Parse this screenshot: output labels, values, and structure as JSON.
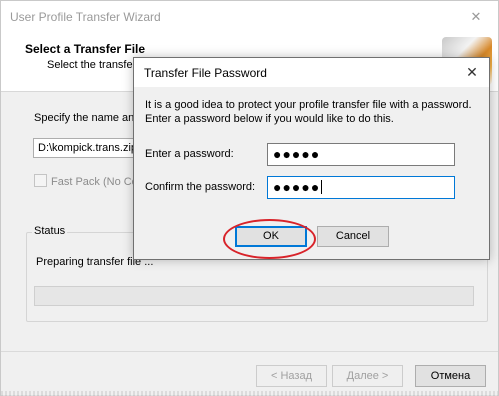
{
  "wizard": {
    "title": "User Profile Transfer Wizard",
    "close_glyph": "✕",
    "header_title": "Select a Transfer File",
    "header_subtitle": "Select the transfer f",
    "specify_label": "Specify the name and",
    "file_path": "D:\\kompick.trans.zip",
    "fast_pack_label": "Fast Pack (No Co",
    "status_label": "Status",
    "status_text": "Preparing transfer file ...",
    "progress": 0,
    "back_label": "< Назад",
    "next_label": "Далее >",
    "cancel_label": "Отмена"
  },
  "dialog": {
    "title": "Transfer File Password",
    "close_glyph": "✕",
    "message_line1": "It is a good idea to protect your profile transfer file with a password.",
    "message_line2": "Enter a password below if you would like to do this.",
    "password_label": "Enter a password:",
    "password_value": "●●●●●",
    "confirm_label": "Confirm the password:",
    "confirm_value": "●●●●●",
    "ok_label": "OK",
    "cancel_label": "Cancel"
  },
  "colors": {
    "accent": "#0078d7",
    "highlight": "#d8232a"
  }
}
